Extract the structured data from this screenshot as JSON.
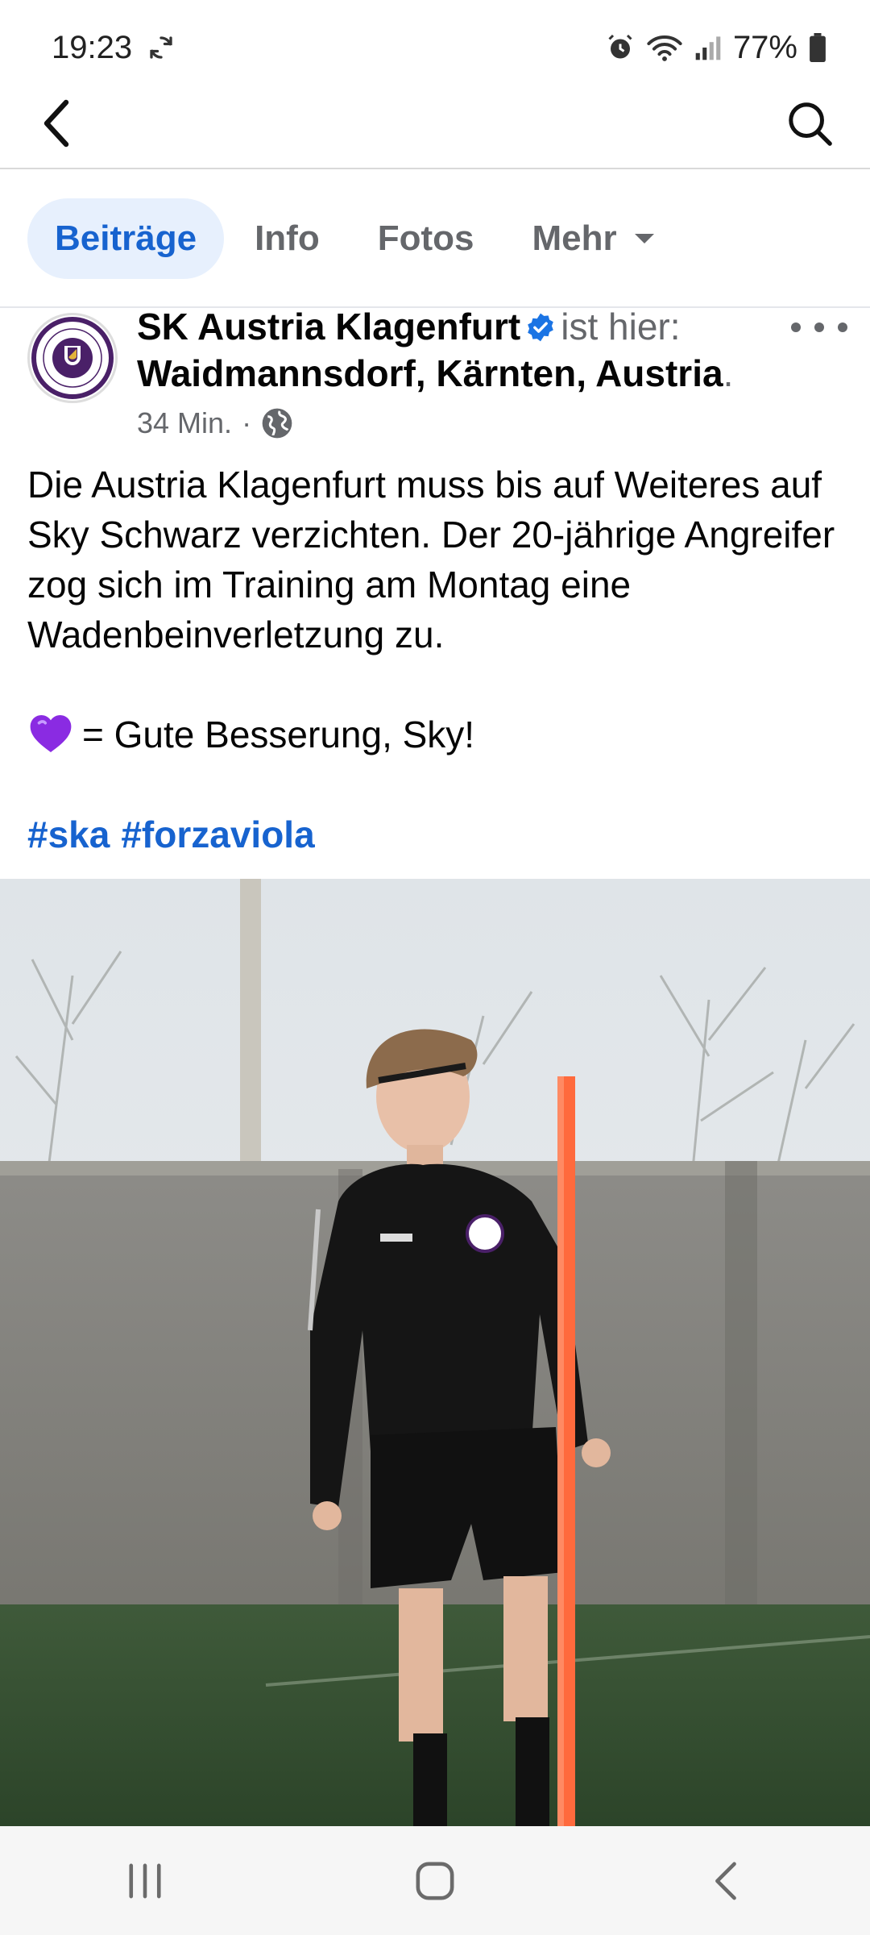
{
  "status_bar": {
    "time": "19:23",
    "battery": "77%"
  },
  "tabs": [
    {
      "label": "Beiträge",
      "active": true
    },
    {
      "label": "Info",
      "active": false
    },
    {
      "label": "Fotos",
      "active": false
    },
    {
      "label": "Mehr",
      "active": false
    }
  ],
  "post": {
    "author": "SK Austria Klagenfurt",
    "location_prefix": "ist hier:",
    "location": "Waidmannsdorf, Kärnten, Austria",
    "location_suffix": ".",
    "time": "34 Min.",
    "separator": "·",
    "text": "Die Austria Klagenfurt muss bis auf Weiteres auf Sky Schwarz verzichten. Der 20-jährige Angreifer zog sich im Training am Montag eine Wadenbeinverletzung zu.",
    "line2": "= Gute Besserung, Sky!",
    "hashtags": [
      "#ska",
      "#forzaviola"
    ]
  },
  "colors": {
    "accent": "#1763cf",
    "tab_active_bg": "#e7f0fd",
    "secondary_text": "#65676b",
    "heart": "#8a2be2",
    "club_purple": "#4a2068"
  },
  "icons": {
    "sync": "sync-icon",
    "alarm": "alarm-icon",
    "wifi": "wifi-icon",
    "signal": "signal-icon",
    "battery": "battery-icon",
    "back": "back-arrow-icon",
    "search": "search-icon",
    "verified": "verified-badge-icon",
    "globe": "globe-icon",
    "more": "more-options-icon",
    "heart": "purple-heart-emoji-icon"
  }
}
